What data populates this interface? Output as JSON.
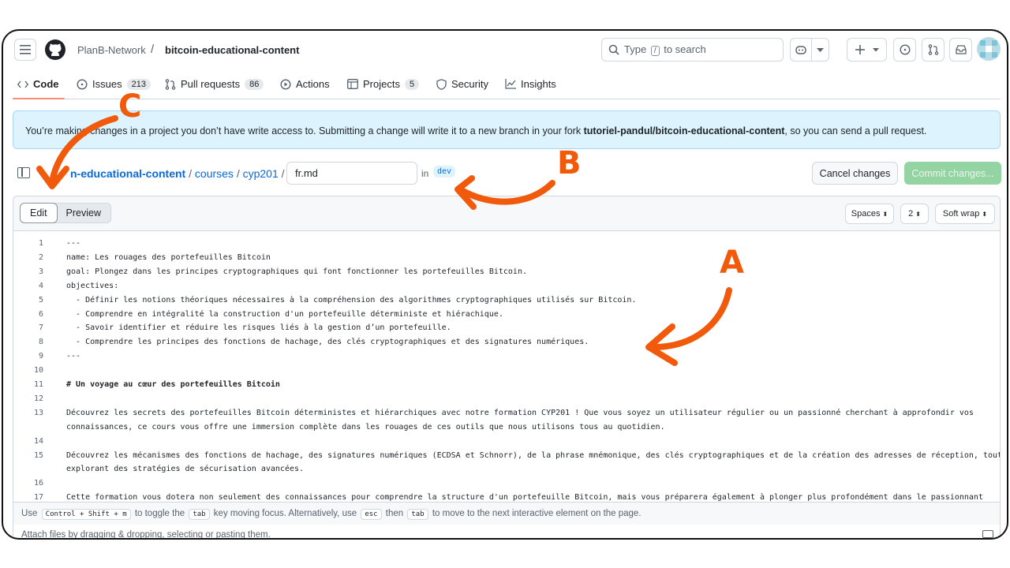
{
  "header": {
    "owner": "PlanB-Network",
    "separator": "/",
    "repo": "bitcoin-educational-content",
    "search_pre": "Type",
    "search_key": "/",
    "search_post": "to search"
  },
  "tabs": [
    {
      "label": "Code",
      "icon": "code-icon"
    },
    {
      "label": "Issues",
      "count": "213",
      "icon": "issue-icon"
    },
    {
      "label": "Pull requests",
      "count": "86",
      "icon": "pull-request-icon"
    },
    {
      "label": "Actions",
      "icon": "play-icon"
    },
    {
      "label": "Projects",
      "count": "5",
      "icon": "table-icon"
    },
    {
      "label": "Security",
      "icon": "shield-icon"
    },
    {
      "label": "Insights",
      "icon": "graph-icon"
    }
  ],
  "notice": {
    "pre": "You’re making changes in a project you don’t have write access to. Submitting a change will write it to a new branch in your fork ",
    "fork": "tutoriel-pandul/bitcoin-educational-content",
    "post": ", so you can send a pull request."
  },
  "path": {
    "repo_fragment": "n-educational-content",
    "folder1": "courses",
    "folder2": "cyp201",
    "sep": "/",
    "filename": "fr.md",
    "in_label": "in",
    "branch": "dev"
  },
  "actions": {
    "cancel": "Cancel changes",
    "commit": "Commit changes..."
  },
  "editor": {
    "tab_edit": "Edit",
    "tab_preview": "Preview",
    "indent_mode": "Spaces",
    "indent_size": "2",
    "wrap_mode": "Soft wrap"
  },
  "code_lines": [
    {
      "n": "1",
      "text": "---"
    },
    {
      "n": "2",
      "text": "name: Les rouages des portefeuilles Bitcoin"
    },
    {
      "n": "3",
      "text": "goal: Plongez dans les principes cryptographiques qui font fonctionner les portefeuilles Bitcoin."
    },
    {
      "n": "4",
      "text": "objectives:"
    },
    {
      "n": "5",
      "text": "  - Définir les notions théoriques nécessaires à la compréhension des algorithmes cryptographiques utilisés sur Bitcoin."
    },
    {
      "n": "6",
      "text": "  - Comprendre en intégralité la construction d'un portefeuille déterministe et hiérachique."
    },
    {
      "n": "7",
      "text": "  - Savoir identifier et réduire les risques liés à la gestion d’un portefeuille."
    },
    {
      "n": "8",
      "text": "  - Comprendre les principes des fonctions de hachage, des clés cryptographiques et des signatures numériques."
    },
    {
      "n": "9",
      "text": "---"
    },
    {
      "n": "10",
      "text": ""
    },
    {
      "n": "11",
      "text": "# Un voyage au cœur des portefeuilles Bitcoin",
      "bold": true
    },
    {
      "n": "12",
      "text": ""
    },
    {
      "n": "13",
      "text": "Découvrez les secrets des portefeuilles Bitcoin déterministes et hiérarchiques avec notre formation CYP201 ! Que vous soyez un utilisateur régulier ou un passionné cherchant à approfondir vos",
      "cont": "connaissances, ce cours vous offre une immersion complète dans les rouages de ces outils que nous utilisons tous au quotidien."
    },
    {
      "n": "14",
      "text": ""
    },
    {
      "n": "15",
      "text": "Découvrez les mécanismes des fonctions de hachage, des signatures numériques (ECDSA et Schnorr), de la phrase mnémonique, des clés cryptographiques et de la création des adresses de réception, tout en",
      "cont": "explorant des stratégies de sécurisation avancées."
    },
    {
      "n": "16",
      "text": ""
    },
    {
      "n": "17",
      "text": "Cette formation vous dotera non seulement des connaissances pour comprendre la structure d'un portefeuille Bitcoin, mais vous préparera également à plonger plus profondément dans le passionnant"
    }
  ],
  "footer": {
    "use": "Use",
    "key1": "Control + Shift + m",
    "t1": "to toggle the",
    "key2": "tab",
    "t2": "key moving focus. Alternatively, use",
    "key3": "esc",
    "t3": "then",
    "key4": "tab",
    "t4": "to move to the next interactive element on the page.",
    "attach": "Attach files by dragging & dropping, selecting or pasting them."
  },
  "annotations": {
    "a": "A",
    "b": "B",
    "c": "C"
  },
  "colors": {
    "annotation": "#f15a0a",
    "accent": "#0969da",
    "commit_disabled": "#94d3a2"
  }
}
